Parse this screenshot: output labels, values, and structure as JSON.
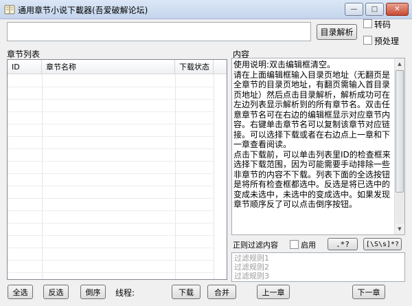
{
  "window": {
    "title": "通用章节小说下載器(吾爱破解论坛)",
    "minimize_glyph": "—",
    "maximize_glyph": "□",
    "close_glyph": "✕"
  },
  "toolbar": {
    "url_input_value": "",
    "parse_button": "目录解析",
    "transcode_label": "转码",
    "preprocess_label": "预处理"
  },
  "chapter_list": {
    "label": "章节列表",
    "columns": [
      "ID",
      "章节名称",
      "下载状态"
    ]
  },
  "content": {
    "label": "内容",
    "text": "使用说明:双击编辑框清空。\n请在上面编辑框输入目录页地址（无翻页是全章节的目录页地址，有翻页需输入首目录页地址）然后点击目录解析，解析成功可在左边列表显示解析到的所有章节名。双击任意章节名可在右边的编辑框显示对应章节内容。右键单击章节名可以复制该章节对应链接。可以选择下载或者在右边点上一章和下一章查看阅读。\n点击下载前，可以单击列表里ID的检查框来选择下载范围，因为可能需要手动排除一些非章节的内容不下载。列表下面的全选按钮是将所有检查框都选中。反选是将已选中的变成未选中，未选中的变成选中。如果发现章节顺序反了可以点击倒序按钮。"
  },
  "regex_filter": {
    "label": "正则过滤内容",
    "enable_label": "启用",
    "pattern_button_1": ".*?",
    "pattern_button_2": "[\\S\\s]*?",
    "rules": [
      "过滤规则1",
      "过滤规则2",
      "过滤规则3"
    ]
  },
  "bottom": {
    "select_all": "全选",
    "invert": "反选",
    "reverse": "倒序",
    "threads_label": "线程:",
    "download": "下载",
    "merge": "合并",
    "prev_chapter": "上一章",
    "next_chapter": "下一章"
  },
  "colors": {
    "titlebar": "#c4d5ec",
    "close_button": "#c74a33",
    "window_bg": "#f0f0f0"
  }
}
